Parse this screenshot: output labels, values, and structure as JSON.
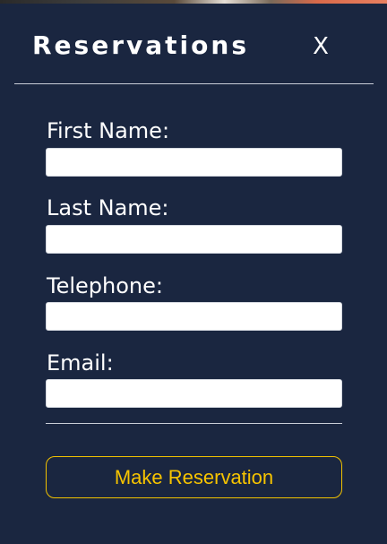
{
  "modal": {
    "title": "Reservations",
    "close_label": "X"
  },
  "form": {
    "fields": [
      {
        "label": "First Name:",
        "value": ""
      },
      {
        "label": "Last Name:",
        "value": ""
      },
      {
        "label": "Telephone:",
        "value": ""
      },
      {
        "label": "Email:",
        "value": ""
      }
    ],
    "submit_label": "Make Reservation"
  },
  "colors": {
    "background": "#1a2640",
    "accent": "#f7c400",
    "text": "#ffffff"
  }
}
